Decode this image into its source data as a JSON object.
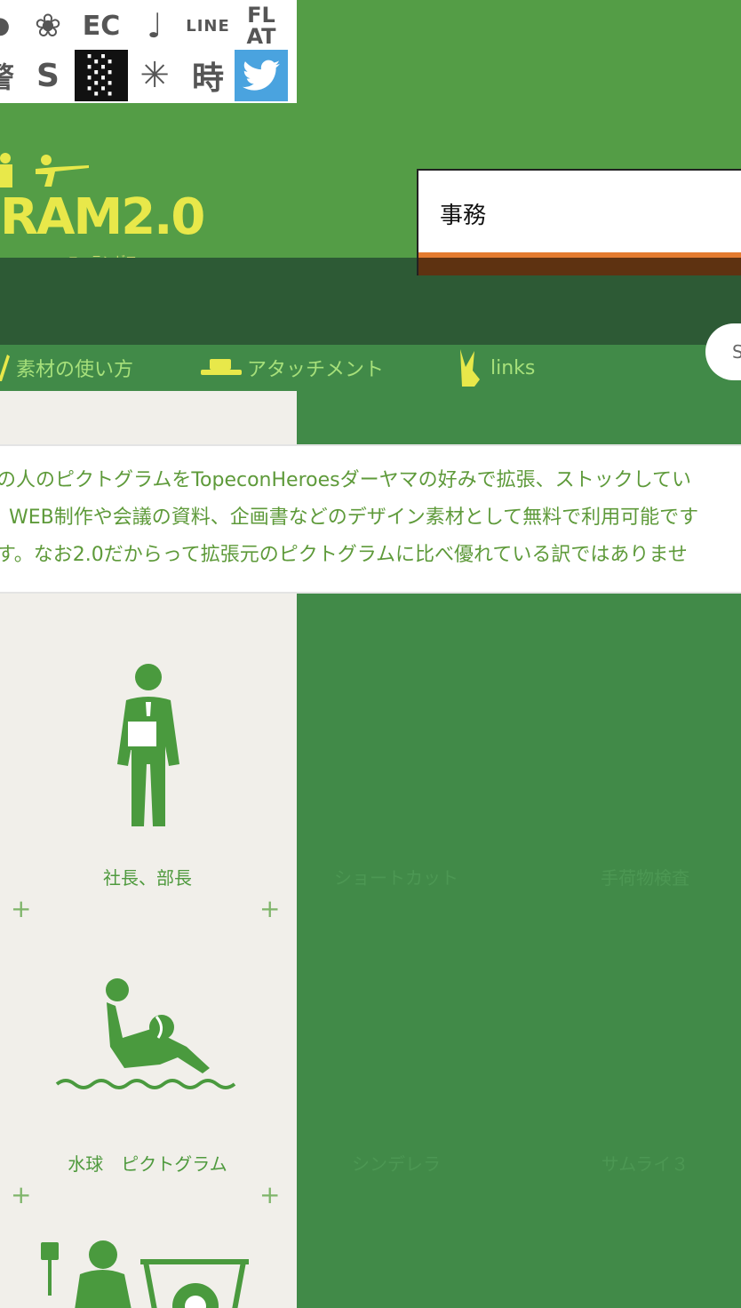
{
  "icon_strip": {
    "row1": [
      "●",
      "❀",
      "EC",
      "♩",
      "LINE",
      "FL AT"
    ],
    "row2": [
      "警",
      "S",
      "░",
      "✳",
      "時",
      "🐦"
    ]
  },
  "header": {
    "logo_text": "RAM2.0",
    "logo_ruby": "ニーテンゼロ",
    "search_value": "事務"
  },
  "nav": {
    "items": [
      {
        "icon": "stick-icon",
        "label": "素材の使い方"
      },
      {
        "icon": "hat-icon",
        "label": "アタッチメント"
      },
      {
        "icon": "rabbit-icon",
        "label": "links"
      }
    ],
    "pill_text": "S"
  },
  "description": {
    "lines": [
      "の人のピクトグラムをTopeconHeroesダーヤマの好みで拡張、ストックしてい",
      "WEB制作や会議の資料、企画書などのデザイン素材として無料で利用可能です",
      "す。なお2.0だからって拡張元のピクトグラムに比べ優れている訳ではありませ"
    ]
  },
  "grid": {
    "row1": [
      "社長、部長",
      "ショートカット",
      "手荷物検査"
    ],
    "row2": [
      "水球　ピクトグラム",
      "シンデレラ",
      "サムライ３"
    ]
  },
  "colors": {
    "background_green": "#549d46",
    "nav_green": "#418a48",
    "dark_band": "#2d5a35",
    "accent_orange": "#e47b2f",
    "text_green": "#5e9a3a",
    "logo_yellow": "#e8e84a"
  }
}
